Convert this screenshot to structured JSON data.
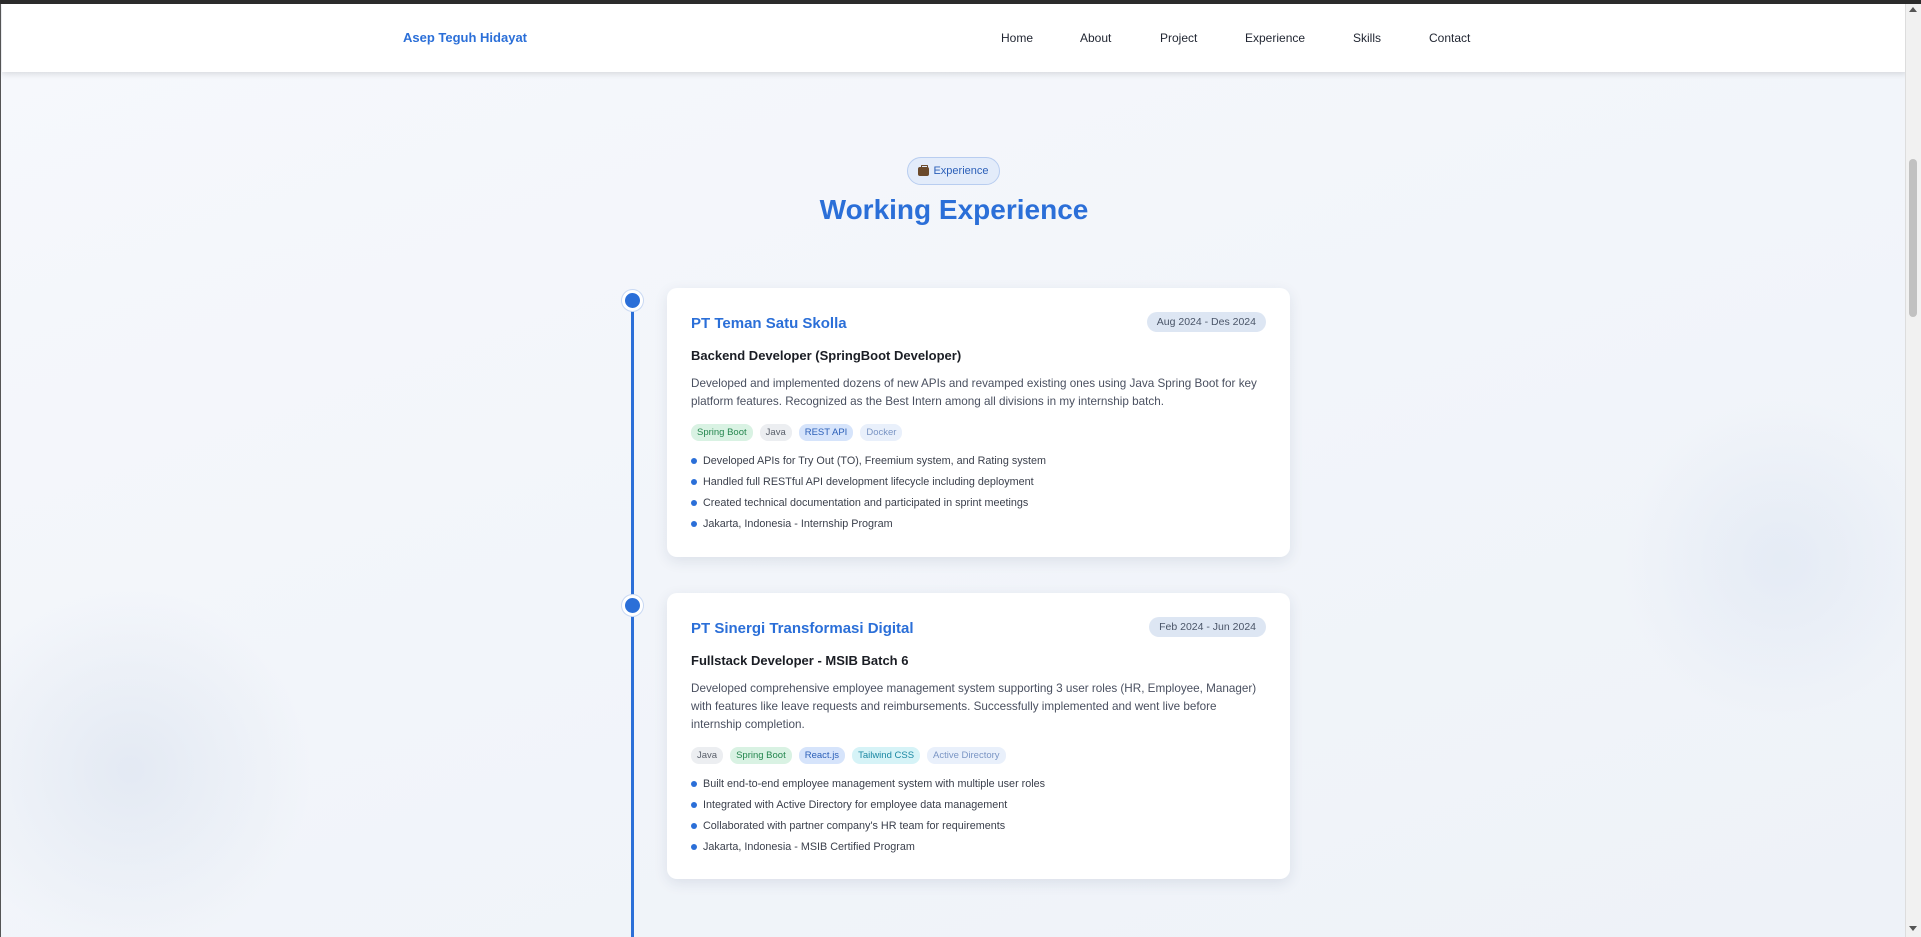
{
  "navbar": {
    "brand": "Asep Teguh Hidayat",
    "items": [
      {
        "label": "Home"
      },
      {
        "label": "About"
      },
      {
        "label": "Project"
      },
      {
        "label": "Experience"
      },
      {
        "label": "Skills"
      },
      {
        "label": "Contact"
      }
    ]
  },
  "section": {
    "badge_label": "Experience",
    "badge_icon": "briefcase-icon",
    "title": "Working Experience"
  },
  "experiences": [
    {
      "company": "PT Teman Satu Skolla",
      "period": "Aug 2024 - Des 2024",
      "role": "Backend Developer (SpringBoot Developer)",
      "description": "Developed and implemented dozens of new APIs and revamped existing ones using Java Spring Boot for key platform features. Recognized as the Best Intern among all divisions in my internship batch.",
      "tags": [
        "Spring Boot",
        "Java",
        "REST API",
        "Docker"
      ],
      "bullets": [
        "Developed APIs for Try Out (TO), Freemium system, and Rating system",
        "Handled full RESTful API development lifecycle including deployment",
        "Created technical documentation and participated in sprint meetings",
        "Jakarta, Indonesia - Internship Program"
      ]
    },
    {
      "company": "PT Sinergi Transformasi Digital",
      "period": "Feb 2024 - Jun 2024",
      "role": "Fullstack Developer - MSIB Batch 6",
      "description": "Developed comprehensive employee management system supporting 3 user roles (HR, Employee, Manager) with features like leave requests and reimbursements. Successfully implemented and went live before internship completion.",
      "tags": [
        "Java",
        "Spring Boot",
        "React.js",
        "Tailwind CSS",
        "Active Directory"
      ],
      "bullets": [
        "Built end-to-end employee management system with multiple user roles",
        "Integrated with Active Directory for employee data management",
        "Collaborated with partner company's HR team for requirements",
        "Jakarta, Indonesia - MSIB Certified Program"
      ]
    }
  ],
  "colors": {
    "accent": "#2b6fd8",
    "background": "#f3f6fb"
  }
}
